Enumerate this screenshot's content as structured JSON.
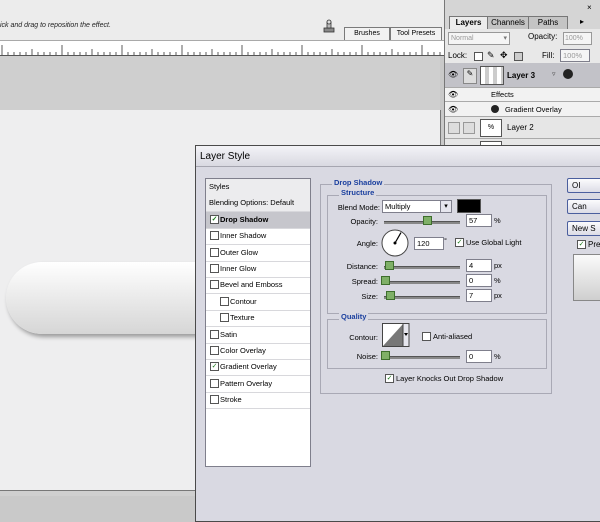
{
  "options_bar": {
    "hint": "ick and drag to reposition the effect.",
    "tabs": [
      "Brushes",
      "Tool Presets"
    ]
  },
  "layers_panel": {
    "tabs": [
      "Layers",
      "Channels",
      "Paths"
    ],
    "close_glyph": "×",
    "blend_mode": "Normal",
    "opacity_label": "Opacity:",
    "opacity_value": "100%",
    "lock_label": "Lock:",
    "fill_label": "Fill:",
    "fill_value": "100%",
    "layers": [
      {
        "name": "Layer 3",
        "selected": true
      },
      {
        "name": "Effects"
      },
      {
        "name": "Gradient Overlay"
      },
      {
        "name": "Layer 2"
      }
    ]
  },
  "dialog": {
    "title": "Layer Style",
    "styles_list": [
      {
        "label": "Styles",
        "kind": "header"
      },
      {
        "label": "Blending Options: Default",
        "kind": "header"
      },
      {
        "label": "Drop Shadow",
        "checked": true,
        "selected": true
      },
      {
        "label": "Inner Shadow",
        "checked": false
      },
      {
        "label": "Outer Glow",
        "checked": false
      },
      {
        "label": "Inner Glow",
        "checked": false
      },
      {
        "label": "Bevel and Emboss",
        "checked": false
      },
      {
        "label": "Contour",
        "checked": false,
        "indent": true
      },
      {
        "label": "Texture",
        "checked": false,
        "indent": true
      },
      {
        "label": "Satin",
        "checked": false
      },
      {
        "label": "Color Overlay",
        "checked": false
      },
      {
        "label": "Gradient Overlay",
        "checked": true
      },
      {
        "label": "Pattern Overlay",
        "checked": false
      },
      {
        "label": "Stroke",
        "checked": false
      }
    ],
    "drop_shadow": {
      "section_title": "Drop Shadow",
      "structure_title": "Structure",
      "blend_mode_label": "Blend Mode:",
      "blend_mode_value": "Multiply",
      "shadow_color": "#000000",
      "opacity_label": "Opacity:",
      "opacity_value": "57",
      "opacity_fraction": 0.57,
      "angle_label": "Angle:",
      "angle_value": "120",
      "degree_symbol": "°",
      "global_light_label": "Use Global Light",
      "global_light_checked": true,
      "distance_label": "Distance:",
      "distance_value": "4",
      "spread_label": "Spread:",
      "spread_value": "0",
      "size_label": "Size:",
      "size_value": "7",
      "px_unit": "px",
      "percent_unit": "%"
    },
    "quality": {
      "title": "Quality",
      "contour_label": "Contour:",
      "anti_aliased_label": "Anti-aliased",
      "anti_aliased_checked": false,
      "noise_label": "Noise:",
      "noise_value": "0"
    },
    "knockout_label": "Layer Knocks Out Drop Shadow",
    "knockout_checked": true,
    "buttons": {
      "ok": "OI",
      "cancel": "Can",
      "new_style": "New S",
      "preview": "Pre"
    }
  }
}
